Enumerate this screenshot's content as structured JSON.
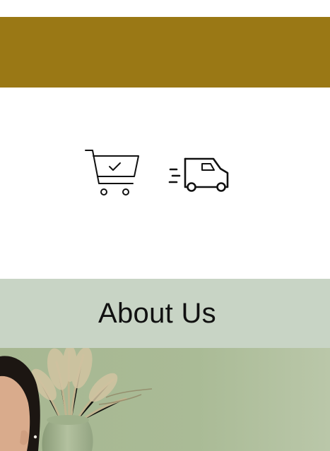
{
  "colors": {
    "banner": "#9a7815",
    "about_band": "#c8d4c5",
    "photo_backdrop": "#a9b993"
  },
  "features": {
    "icons": [
      "shopping-cart-check-icon",
      "delivery-truck-icon"
    ]
  },
  "about": {
    "title": "About Us",
    "image": "about-us-photo"
  }
}
